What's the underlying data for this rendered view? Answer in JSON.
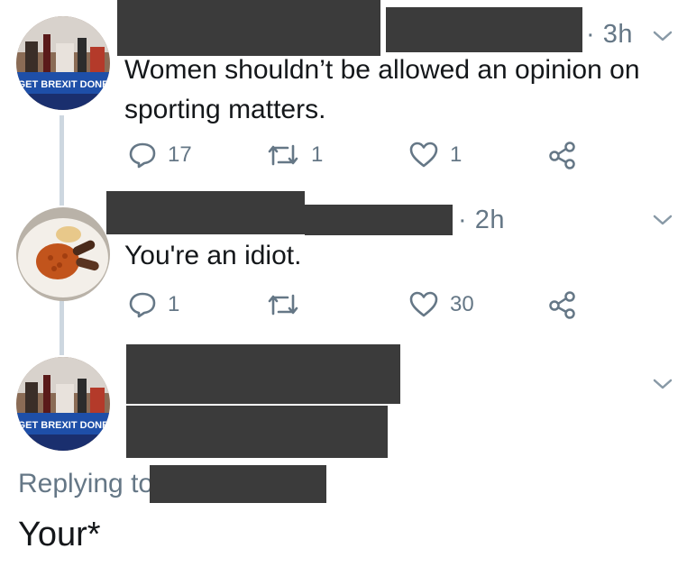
{
  "tweets": [
    {
      "avatar": "brexit-bus-avatar",
      "avatar_caption": "GET BREXIT DONE",
      "time": "· 3h",
      "text_lines": [
        "Women shouldn’t be allowed an opinion on",
        "sporting matters."
      ],
      "replies": "17",
      "retweets": "1",
      "likes": "1"
    },
    {
      "avatar": "food-plate-avatar",
      "time": "· 2h",
      "text_lines": [
        "You're an idiot."
      ],
      "replies": "1",
      "retweets": "",
      "likes": "30"
    },
    {
      "avatar": "brexit-bus-avatar",
      "avatar_caption": "GET BREXIT DONE"
    }
  ],
  "reply": {
    "replying_label": "Replying to",
    "text": "Your*"
  },
  "icons": {
    "reply": "reply-icon",
    "retweet": "retweet-icon",
    "like": "heart-icon",
    "share": "share-icon",
    "menu": "chevron-down-icon"
  },
  "colors": {
    "secondary_text": "#657786",
    "primary_text": "#14171a",
    "redaction": "#3b3b3b",
    "thread_line": "#cdd7e0"
  }
}
